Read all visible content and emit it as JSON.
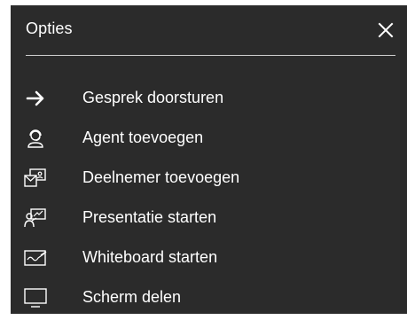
{
  "panel": {
    "title": "Opties",
    "close_icon": "close-icon"
  },
  "menu": {
    "items": [
      {
        "label": "Gesprek doorsturen",
        "icon": "arrow-right-icon"
      },
      {
        "label": "Agent toevoegen",
        "icon": "headset-agent-icon"
      },
      {
        "label": "Deelnemer toevoegen",
        "icon": "add-participant-icon"
      },
      {
        "label": "Presentatie starten",
        "icon": "presentation-icon"
      },
      {
        "label": "Whiteboard starten",
        "icon": "whiteboard-icon"
      },
      {
        "label": "Scherm delen",
        "icon": "monitor-icon"
      }
    ]
  },
  "colors": {
    "panel_background": "#2b2b2b",
    "text": "#ffffff",
    "divider": "#cfcfcf"
  }
}
